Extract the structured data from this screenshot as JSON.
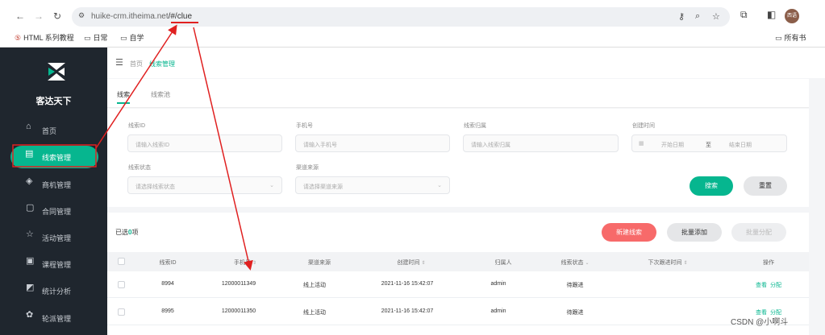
{
  "browser": {
    "url_host": "huike-crm.itheima.net",
    "url_path": "/#/clue",
    "bookmarks": [
      "HTML 系列教程",
      "日常",
      "自学"
    ],
    "all_bookmarks": "所有书",
    "avatar_text": "西语"
  },
  "sidebar": {
    "brand": "客达天下",
    "items": [
      {
        "label": "首页",
        "icon": "⌂"
      },
      {
        "label": "线索管理",
        "icon": "▤"
      },
      {
        "label": "商机管理",
        "icon": "◈"
      },
      {
        "label": "合同管理",
        "icon": "▢"
      },
      {
        "label": "活动管理",
        "icon": "☆"
      },
      {
        "label": "课程管理",
        "icon": "▣"
      },
      {
        "label": "统计分析",
        "icon": "◩"
      },
      {
        "label": "轮派管理",
        "icon": "✿"
      }
    ]
  },
  "breadcrumb": {
    "home": "首页",
    "current": "线索管理"
  },
  "tabs": [
    "线索",
    "线索池"
  ],
  "filters": {
    "clue_id": {
      "label": "线索ID",
      "placeholder": "请输入线索ID"
    },
    "phone": {
      "label": "手机号",
      "placeholder": "请输入手机号"
    },
    "owner": {
      "label": "线索归属",
      "placeholder": "请输入线索归属"
    },
    "create_time": {
      "label": "创建时间",
      "start": "开始日期",
      "to": "至",
      "end": "结束日期"
    },
    "status": {
      "label": "线索状态",
      "placeholder": "请选择线索状态"
    },
    "channel": {
      "label": "渠道来源",
      "placeholder": "请选择渠道来源"
    },
    "search": "搜索",
    "reset": "重置"
  },
  "list": {
    "selected_prefix": "已选",
    "selected_count": "0",
    "selected_suffix": "项",
    "new_clue": "新建线索",
    "batch_add": "批量添加",
    "batch_assign": "批量分配",
    "columns": [
      "线索ID",
      "手机号",
      "渠道来源",
      "创建时间",
      "归属人",
      "线索状态",
      "下次跟进时间",
      "操作"
    ],
    "rows": [
      {
        "id": "8994",
        "phone": "12000011349",
        "channel": "线上活动",
        "created": "2021-11-16 15:42:07",
        "owner": "admin",
        "status": "待跟进",
        "next": "",
        "ops": [
          "查看",
          "分配"
        ]
      },
      {
        "id": "8995",
        "phone": "12000011350",
        "channel": "线上活动",
        "created": "2021-11-16 15:42:07",
        "owner": "admin",
        "status": "待跟进",
        "next": "",
        "ops": [
          "查看",
          "分配"
        ]
      }
    ]
  },
  "watermark": "CSDN @小啊斗",
  "colors": {
    "accent": "#06b68f",
    "sidebar": "#1f262e",
    "danger": "#f76a6a",
    "annotation": "#e02020"
  }
}
